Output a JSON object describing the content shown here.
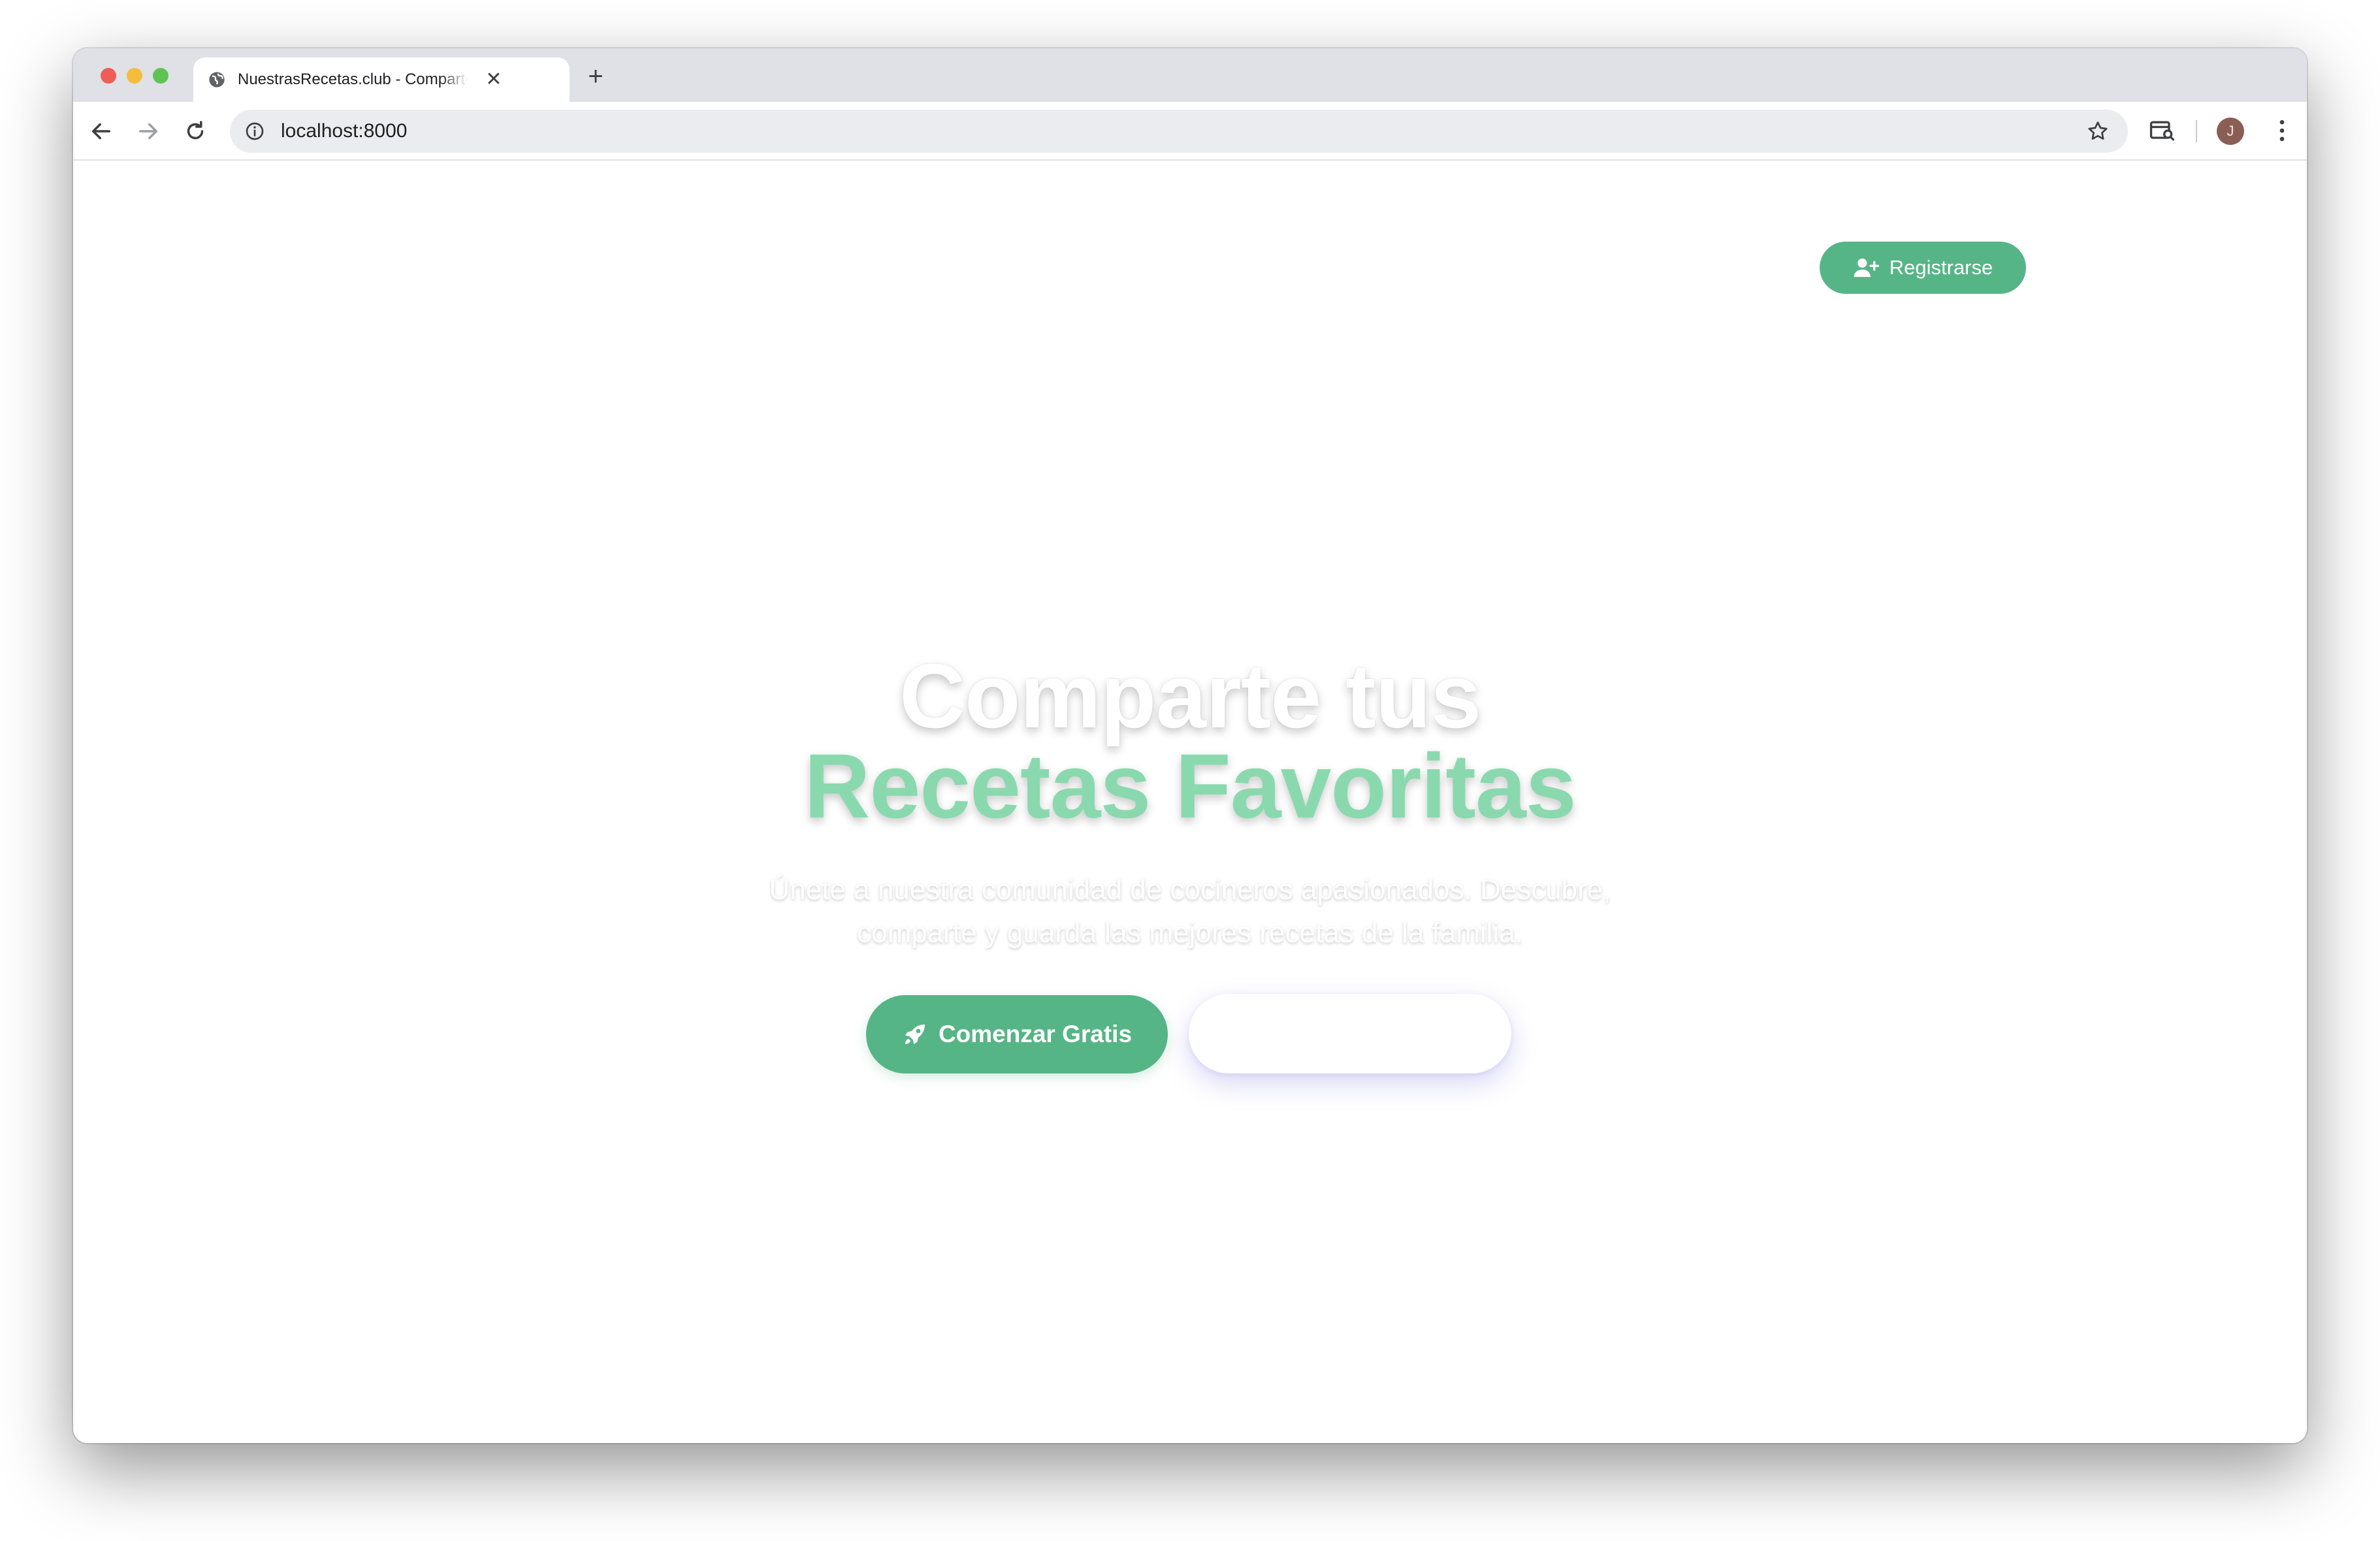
{
  "browser": {
    "tab_title": "NuestrasRecetas.club - Comparte tus Recetas",
    "url": "localhost:8000",
    "profile_initial": "J",
    "new_tab_label": "+",
    "close_tab_label": "✕"
  },
  "header": {
    "register_label": "Registrarse"
  },
  "hero": {
    "title_line1": "Comparte tus",
    "title_line2": "Recetas Favoritas",
    "subtitle": "Únete a nuestra comunidad de cocineros apasionados. Descubre, comparte y guarda las mejores recetas de la familia.",
    "cta_primary": "Comenzar Gratis",
    "cta_secondary": ""
  },
  "colors": {
    "brand_green": "#56b586",
    "title_green": "#8ad9ae",
    "tab_strip": "#dfe1e7",
    "omnibox": "#ebecf0"
  },
  "icons": {
    "tab_favicon": "globe-icon",
    "register": "user-plus-icon",
    "cta_primary": "rocket-icon"
  }
}
